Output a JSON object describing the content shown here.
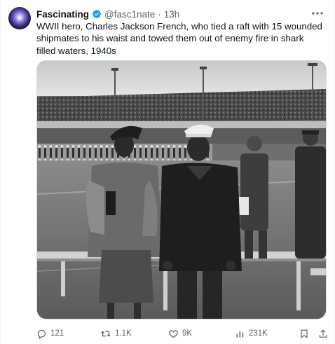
{
  "author": {
    "display_name": "Fascinating",
    "handle": "@fasc1nate",
    "separator": "·",
    "time": "13h",
    "verified": true
  },
  "tweet": {
    "text": "WWII hero, Charles Jackson French, who tied a raft with 15 wounded shipmates to his waist and towed them out of enemy fire in shark filled waters, 1940s"
  },
  "media": {
    "type": "photo",
    "tone": "black-and-white"
  },
  "actions": {
    "replies": "121",
    "retweets": "1.1K",
    "likes": "9K",
    "views": "231K"
  },
  "icons": {
    "verified": "verified-badge-icon",
    "more": "more-icon",
    "reply": "reply-icon",
    "retweet": "retweet-icon",
    "like": "heart-icon",
    "views": "views-icon",
    "bookmark": "bookmark-icon",
    "share": "share-icon"
  },
  "colors": {
    "verified_blue": "#1d9bf0",
    "secondary_text": "#536471",
    "primary_text": "#0f1419",
    "border": "#cfd9de"
  }
}
